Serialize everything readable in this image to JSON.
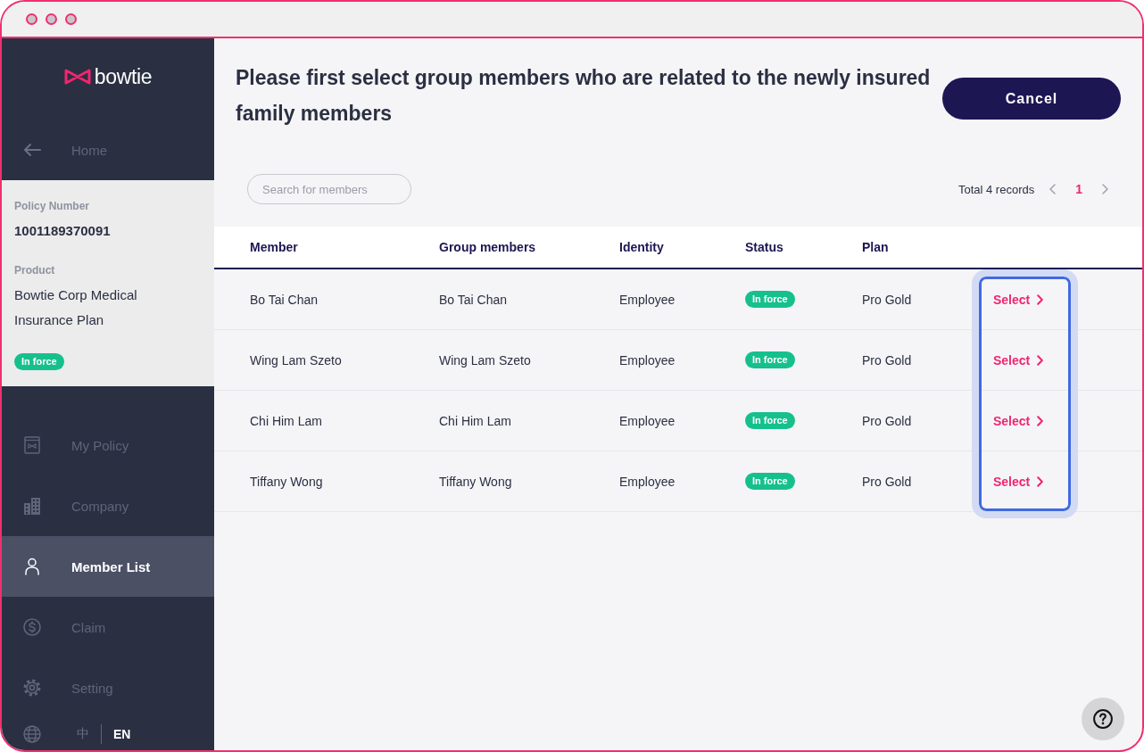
{
  "sidebar": {
    "logo": {
      "text": "bowtie"
    },
    "back_link": {
      "label": "Home"
    },
    "policy": {
      "number_label": "Policy Number",
      "number": "1001189370091",
      "product_label": "Product",
      "product": "Bowtie Corp Medical Insurance Plan",
      "status": "In force"
    },
    "nav": [
      {
        "label": "My Policy",
        "selected": false
      },
      {
        "label": "Company",
        "selected": false
      },
      {
        "label": "Member List",
        "selected": true
      },
      {
        "label": "Claim",
        "selected": false
      },
      {
        "label": "Setting",
        "selected": false
      }
    ],
    "language": [
      {
        "label": "中",
        "selected": false
      },
      {
        "label": "EN",
        "selected": true
      }
    ]
  },
  "main": {
    "title": "Please first select group members who are related to the newly insured family members",
    "cancel_button": "Cancel",
    "search": {
      "placeholder": "Search for members"
    },
    "pagination": {
      "total": "Total 4 records",
      "pages": [
        {
          "label": "1",
          "selected": true
        }
      ]
    },
    "table": {
      "columns": [
        "Member",
        "Group members",
        "Identity",
        "Status",
        "Plan"
      ],
      "rows": [
        {
          "member": "Bo Tai Chan",
          "group_member": "Bo Tai Chan",
          "identity": "Employee",
          "status": "In force",
          "plan": "Pro Gold",
          "action": "Select"
        },
        {
          "member": "Wing Lam Szeto",
          "group_member": "Wing Lam Szeto",
          "identity": "Employee",
          "status": "In force",
          "plan": "Pro Gold",
          "action": "Select"
        },
        {
          "member": "Chi Him Lam",
          "group_member": "Chi Him Lam",
          "identity": "Employee",
          "status": "In force",
          "plan": "Pro Gold",
          "action": "Select"
        },
        {
          "member": "Tiffany Wong",
          "group_member": "Tiffany Wong",
          "identity": "Employee",
          "status": "In force",
          "plan": "Pro Gold",
          "action": "Select"
        }
      ],
      "action_column_highlighted": true
    }
  }
}
